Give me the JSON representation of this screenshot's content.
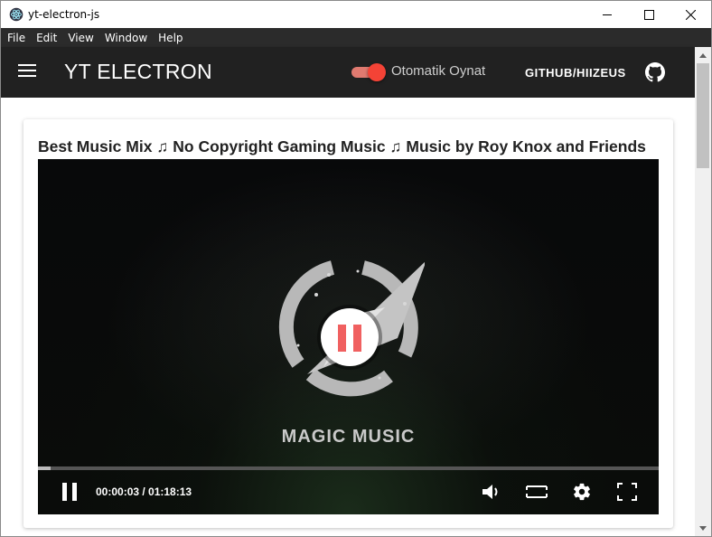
{
  "window": {
    "title": "yt-electron-js"
  },
  "menu": {
    "items": [
      "File",
      "Edit",
      "View",
      "Window",
      "Help"
    ]
  },
  "appbar": {
    "title": "YT ELECTRON",
    "autoplay_label": "Otomatik Oynat",
    "autoplay_on": true,
    "github_label": "GITHUB/HIIZEUS",
    "accent_color": "#f44336"
  },
  "video": {
    "title": "Best Music Mix ♫ No Copyright Gaming Music ♫ Music by Roy Knox and Friends",
    "brand_text": "MAGIC MUSIC",
    "time": "00:00:03 / 01:18:13",
    "progress_fraction": 0.002,
    "controls": [
      "pause-icon",
      "volume-icon",
      "theater-mode-icon",
      "settings-icon",
      "fullscreen-icon"
    ]
  }
}
